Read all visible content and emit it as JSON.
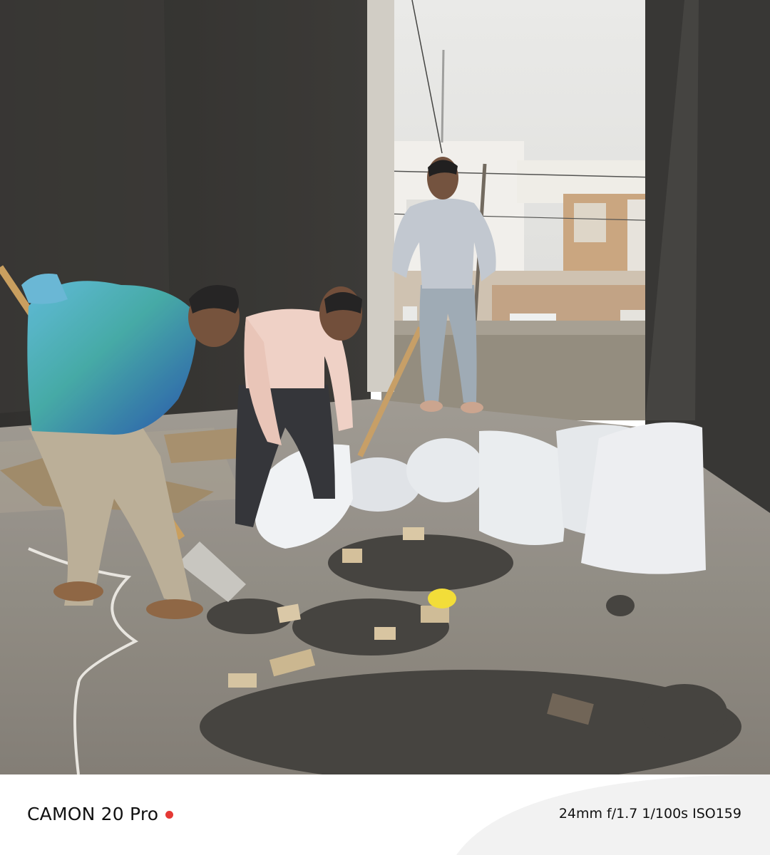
{
  "footer": {
    "camera_model": "CAMON 20 Pro",
    "exif": "24mm f/1.7 1/100s ISO159",
    "rec_dot_color": "#e53935"
  },
  "photo": {
    "subject": "workers-clearing-rubble-scene"
  }
}
